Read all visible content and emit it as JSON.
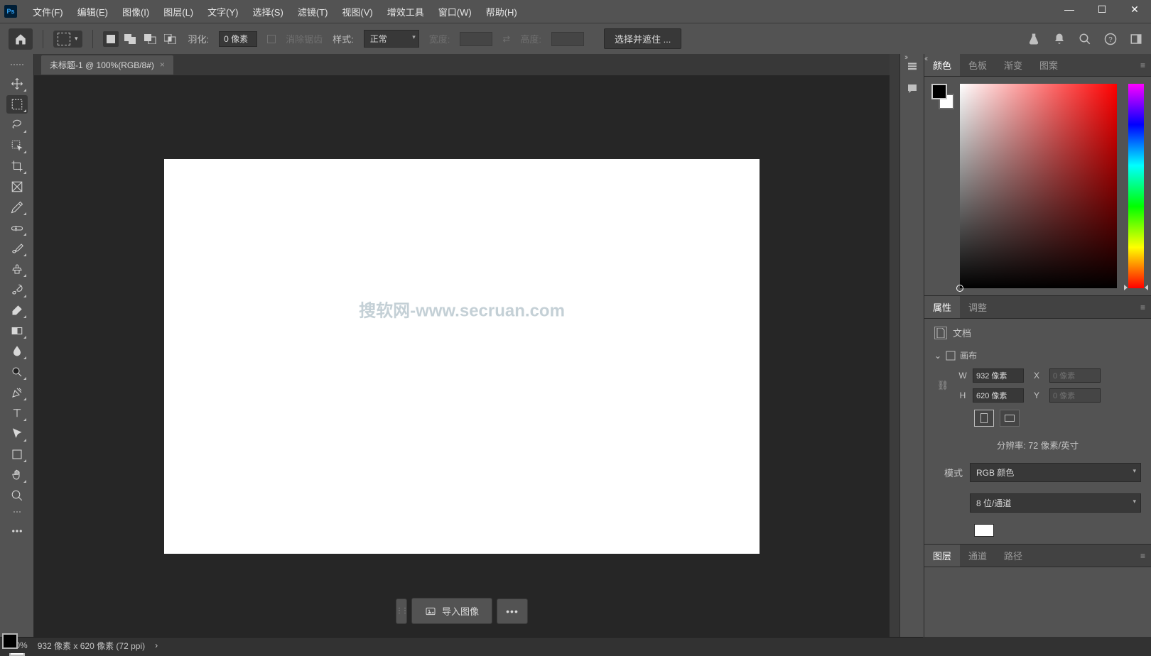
{
  "app": {
    "logo_text": "Ps"
  },
  "menu": [
    "文件(F)",
    "编辑(E)",
    "图像(I)",
    "图层(L)",
    "文字(Y)",
    "选择(S)",
    "滤镜(T)",
    "视图(V)",
    "增效工具",
    "窗口(W)",
    "帮助(H)"
  ],
  "window_controls": {
    "min": "—",
    "max": "☐",
    "close": "✕"
  },
  "options": {
    "feather_label": "羽化:",
    "feather_value": "0 像素",
    "antialias_label": "消除锯齿",
    "style_label": "样式:",
    "style_value": "正常",
    "width_label": "宽度:",
    "swap_icon": "⇄",
    "height_label": "高度:",
    "select_mask_btn": "选择并遮住 ..."
  },
  "doc_tab": {
    "title": "未标题-1 @ 100%(RGB/8#)",
    "close": "×"
  },
  "canvas": {
    "watermark": "搜软网-www.secruan.com"
  },
  "import_bar": {
    "handle": "⋮⋮",
    "label": "导入图像",
    "more": "•••"
  },
  "color_panel": {
    "tabs": [
      "颜色",
      "色板",
      "渐变",
      "图案"
    ]
  },
  "props_panel": {
    "tabs": [
      "属性",
      "调整"
    ],
    "doc_label": "文档",
    "section_canvas": "画布",
    "W": "W",
    "W_val": "932 像素",
    "H": "H",
    "H_val": "620 像素",
    "X": "X",
    "X_val": "0 像素",
    "Y": "Y",
    "Y_val": "0 像素",
    "resolution": "分辨率: 72 像素/英寸",
    "mode_label": "模式",
    "mode_value": "RGB 颜色",
    "depth_value": "8 位/通道"
  },
  "layers_tabs": [
    "图层",
    "通道",
    "路径"
  ],
  "status": {
    "zoom": "100%",
    "info": "932 像素 x 620 像素 (72 ppi)",
    "arrow": "›"
  }
}
